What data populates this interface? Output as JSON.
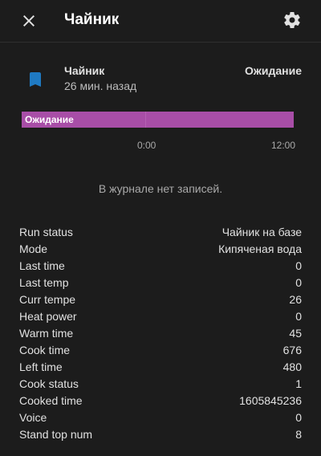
{
  "header": {
    "title": "Чайник",
    "close_icon": "close-icon",
    "settings_icon": "gear-icon"
  },
  "entity": {
    "icon": "bookmark-icon",
    "icon_color": "#1f7ac3",
    "name": "Чайник",
    "last_changed": "26 мин. назад",
    "state": "Ожидание"
  },
  "history": {
    "bar_label": "Ожидание",
    "bar_color": "#a84ea7",
    "ticks": [
      "0:00",
      "12:00"
    ]
  },
  "logbook": {
    "empty_text": "В журнале нет записей."
  },
  "attributes": [
    {
      "name": "Run status",
      "value": "Чайник на базе"
    },
    {
      "name": "Mode",
      "value": "Кипяченая вода"
    },
    {
      "name": "Last time",
      "value": "0"
    },
    {
      "name": "Last temp",
      "value": "0"
    },
    {
      "name": "Curr tempe",
      "value": "26"
    },
    {
      "name": "Heat power",
      "value": "0"
    },
    {
      "name": "Warm time",
      "value": "45"
    },
    {
      "name": "Cook time",
      "value": "676"
    },
    {
      "name": "Left time",
      "value": "480"
    },
    {
      "name": "Cook status",
      "value": "1"
    },
    {
      "name": "Cooked time",
      "value": "1605845236"
    },
    {
      "name": "Voice",
      "value": "0"
    },
    {
      "name": "Stand top num",
      "value": "8"
    }
  ]
}
